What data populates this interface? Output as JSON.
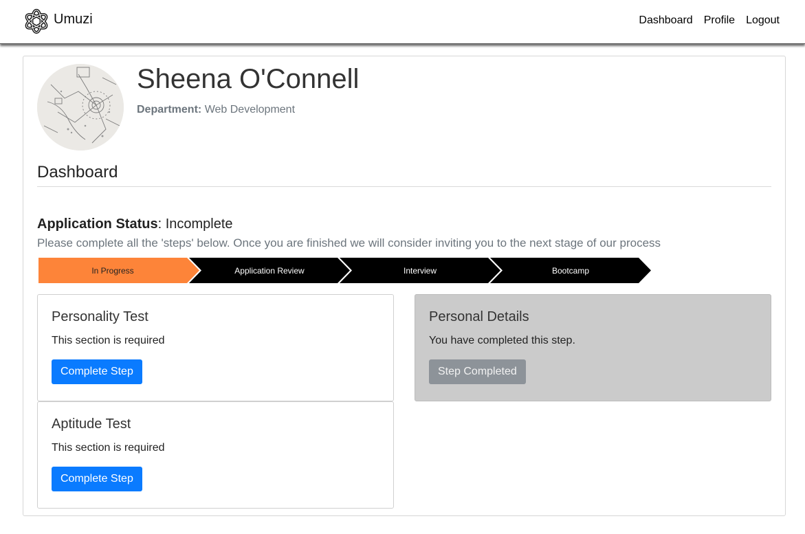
{
  "navbar": {
    "brand": "Umuzi",
    "links": [
      "Dashboard",
      "Profile",
      "Logout"
    ]
  },
  "profile": {
    "name": "Sheena O'Connell",
    "department_label": "Department:",
    "department": "Web Development"
  },
  "dashboard": {
    "heading": "Dashboard",
    "status_label": "Application Status",
    "status_value": ": Incomplete",
    "status_description": "Please complete all the 'steps' below. Once you are finished we will consider inviting you to the next stage of our process"
  },
  "progress_steps": [
    {
      "label": "In Progress",
      "state": "active"
    },
    {
      "label": "Application Review",
      "state": "pending"
    },
    {
      "label": "Interview",
      "state": "pending"
    },
    {
      "label": "Bootcamp",
      "state": "pending"
    }
  ],
  "step_cards": [
    {
      "title": "Personality Test",
      "text": "This section is required",
      "button": "Complete Step",
      "completed": false
    },
    {
      "title": "Aptitude Test",
      "text": "This section is required",
      "button": "Complete Step",
      "completed": false
    },
    {
      "title": "Personal Details",
      "text": "You have completed this step.",
      "button": "Step Completed",
      "completed": true
    }
  ],
  "colors": {
    "active_step": "#fd8439",
    "pending_step": "#000000",
    "primary_button": "#0a7bff",
    "completed_card": "#cbcbcb",
    "completed_button": "#8d9399"
  },
  "icons": {
    "brand_logo": "umuzi-logo-icon"
  }
}
